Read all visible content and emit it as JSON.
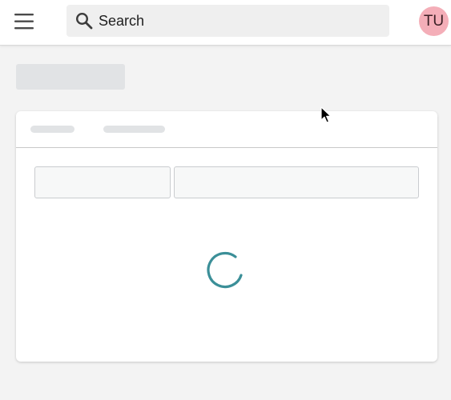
{
  "header": {
    "menu_icon": "hamburger-menu-icon",
    "search": {
      "icon": "search-icon",
      "placeholder": "Search",
      "value": ""
    },
    "avatar": {
      "initials": "TU",
      "color": "#f4aeb8"
    }
  },
  "main": {
    "loading": true,
    "spinner_color": "#3b8f98"
  },
  "colors": {
    "background": "#f3f3f3",
    "skeleton": "#e1e3e5",
    "card": "#ffffff"
  }
}
